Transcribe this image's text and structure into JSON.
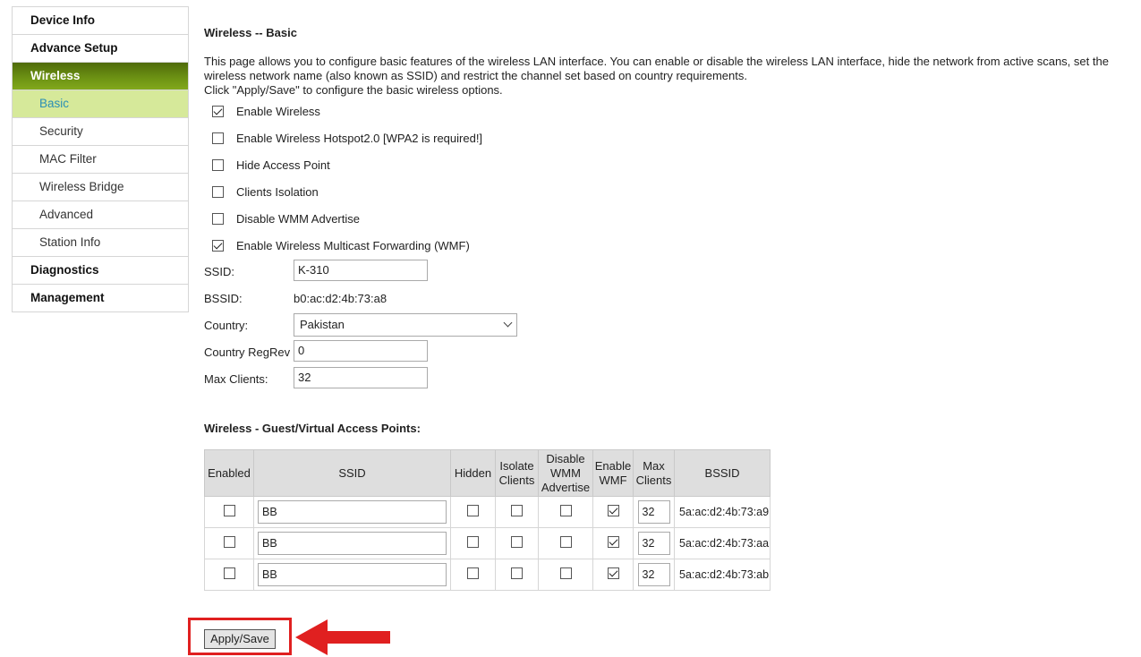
{
  "sidebar": {
    "items": [
      {
        "label": "Device Info"
      },
      {
        "label": "Advance Setup"
      },
      {
        "label": "Wireless"
      },
      {
        "label": "Basic"
      },
      {
        "label": "Security"
      },
      {
        "label": "MAC Filter"
      },
      {
        "label": "Wireless Bridge"
      },
      {
        "label": "Advanced"
      },
      {
        "label": "Station Info"
      },
      {
        "label": "Diagnostics"
      },
      {
        "label": "Management"
      }
    ]
  },
  "page": {
    "title": "Wireless -- Basic",
    "description_1": "This page allows you to configure basic features of the wireless LAN interface. You can enable or disable the wireless LAN interface, hide the network from active scans, set the wireless network name (also known as SSID) and restrict the channel set based on country requirements.",
    "description_2": "Click \"Apply/Save\" to configure the basic wireless options."
  },
  "options": [
    {
      "label": "Enable Wireless",
      "checked": true
    },
    {
      "label": "Enable Wireless Hotspot2.0 [WPA2 is required!]",
      "checked": false
    },
    {
      "label": "Hide Access Point",
      "checked": false
    },
    {
      "label": "Clients Isolation",
      "checked": false
    },
    {
      "label": "Disable WMM Advertise",
      "checked": false
    },
    {
      "label": "Enable Wireless Multicast Forwarding (WMF)",
      "checked": true
    }
  ],
  "fields": {
    "ssid_label": "SSID:",
    "ssid_value": "K-310",
    "bssid_label": "BSSID:",
    "bssid_value": "b0:ac:d2:4b:73:a8",
    "country_label": "Country:",
    "country_value": "Pakistan",
    "regrev_label": "Country RegRev",
    "regrev_value": "0",
    "maxclients_label": "Max Clients:",
    "maxclients_value": "32"
  },
  "guest": {
    "title": "Wireless - Guest/Virtual Access Points:",
    "headers": {
      "enabled": "Enabled",
      "ssid": "SSID",
      "hidden": "Hidden",
      "isolate_1": "Isolate",
      "isolate_2": "Clients",
      "wmm_1": "Disable",
      "wmm_2": "WMM",
      "wmm_3": "Advertise",
      "wmf_1": "Enable",
      "wmf_2": "WMF",
      "max_1": "Max",
      "max_2": "Clients",
      "bssid": "BSSID"
    },
    "rows": [
      {
        "enabled": false,
        "ssid": "BB",
        "hidden": false,
        "isolate": false,
        "wmm": false,
        "wmf": true,
        "max": "32",
        "bssid": "5a:ac:d2:4b:73:a9"
      },
      {
        "enabled": false,
        "ssid": "BB",
        "hidden": false,
        "isolate": false,
        "wmm": false,
        "wmf": true,
        "max": "32",
        "bssid": "5a:ac:d2:4b:73:aa"
      },
      {
        "enabled": false,
        "ssid": "BB",
        "hidden": false,
        "isolate": false,
        "wmm": false,
        "wmf": true,
        "max": "32",
        "bssid": "5a:ac:d2:4b:73:ab"
      }
    ]
  },
  "apply_label": "Apply/Save",
  "colors": {
    "sidebar_active": "#6e9414",
    "sidebar_sub_active_bg": "#d6e99a",
    "sidebar_sub_active_text": "#2b8fb5",
    "highlight_red": "#e02020"
  }
}
